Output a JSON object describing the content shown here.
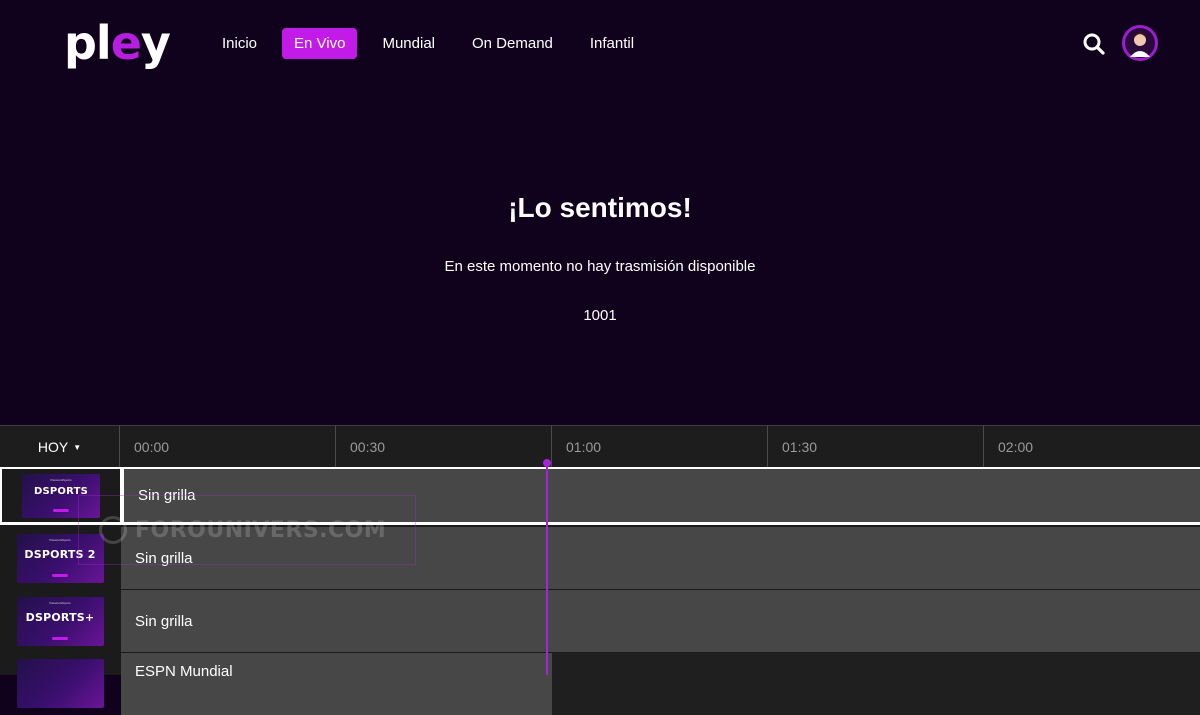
{
  "header": {
    "logo": {
      "main": "pl",
      "accent": "e",
      "tail": "y"
    },
    "nav": [
      {
        "label": "Inicio",
        "active": false
      },
      {
        "label": "En Vivo",
        "active": true
      },
      {
        "label": "Mundial",
        "active": false
      },
      {
        "label": "On Demand",
        "active": false
      },
      {
        "label": "Infantil",
        "active": false
      }
    ],
    "icons": {
      "search": "search-icon",
      "avatar": "user-avatar-icon"
    }
  },
  "message": {
    "title": "¡Lo sentimos!",
    "subtitle": "En este momento no hay trasmisión disponible",
    "code": "1001"
  },
  "epg": {
    "day": "HOY",
    "times": [
      "00:00",
      "00:30",
      "01:00",
      "01:30",
      "02:00"
    ],
    "channels": [
      {
        "logo_text": "DSPORTS",
        "logo_small": "Passion&Sports",
        "program": "Sin grilla"
      },
      {
        "logo_text": "DSPORTS 2",
        "logo_small": "Passion&Sports",
        "program": "Sin grilla"
      },
      {
        "logo_text": "DSPORTS+",
        "logo_small": "Passion&Sports",
        "program": "Sin grilla"
      },
      {
        "logo_text": "",
        "logo_small": "",
        "program": "ESPN Mundial"
      }
    ],
    "watermark": "FOROUNIVERS.COM"
  },
  "colors": {
    "accent": "#c21be8",
    "background": "#10021d",
    "progress": "#a822d8"
  }
}
